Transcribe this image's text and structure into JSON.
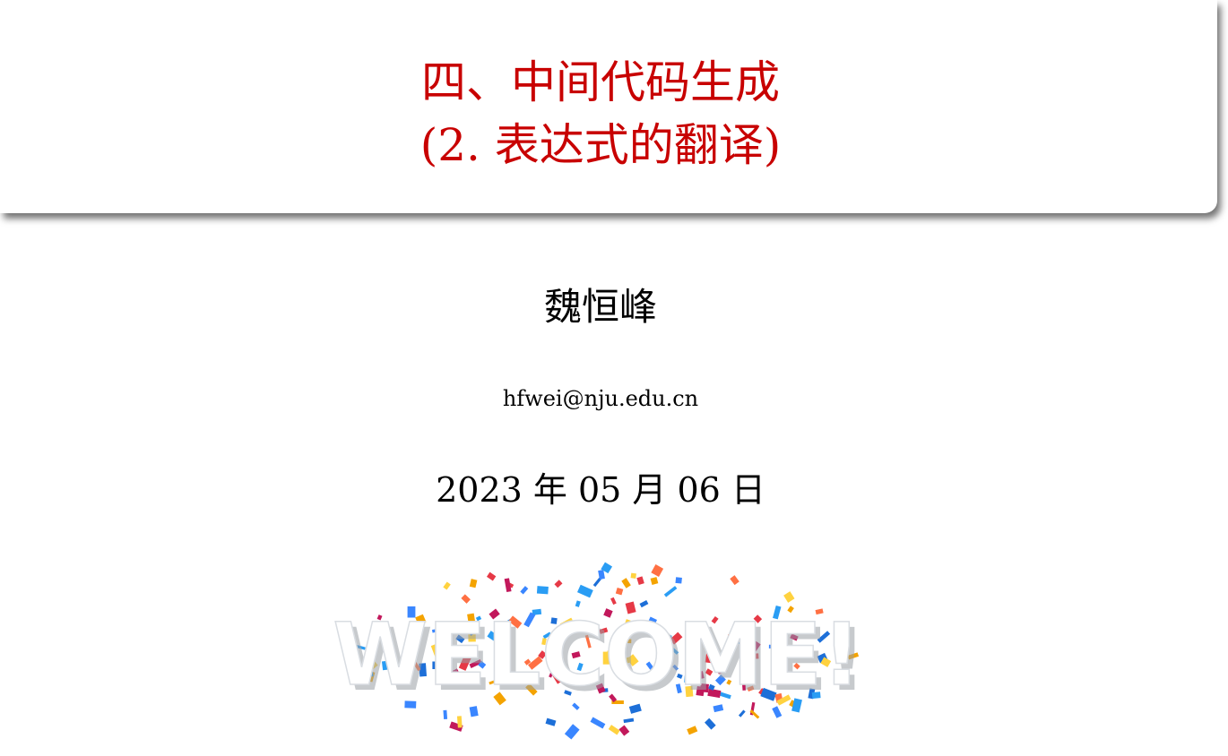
{
  "slide": {
    "title_line1": "四、中间代码生成",
    "title_line2": "(2. 表达式的翻译)",
    "author": "魏恒峰",
    "email": "hfwei@nju.edu.cn",
    "date": "2023 年 05 月 06 日"
  },
  "welcome_image": {
    "text": "WELCOME!",
    "confetti_colors": [
      "#e63946",
      "#f4a300",
      "#1d6fd8",
      "#2a9df4",
      "#c2185b",
      "#ff7043",
      "#ffd23f",
      "#3a86ff"
    ]
  },
  "colors": {
    "title": "#c80000",
    "text": "#000000"
  }
}
